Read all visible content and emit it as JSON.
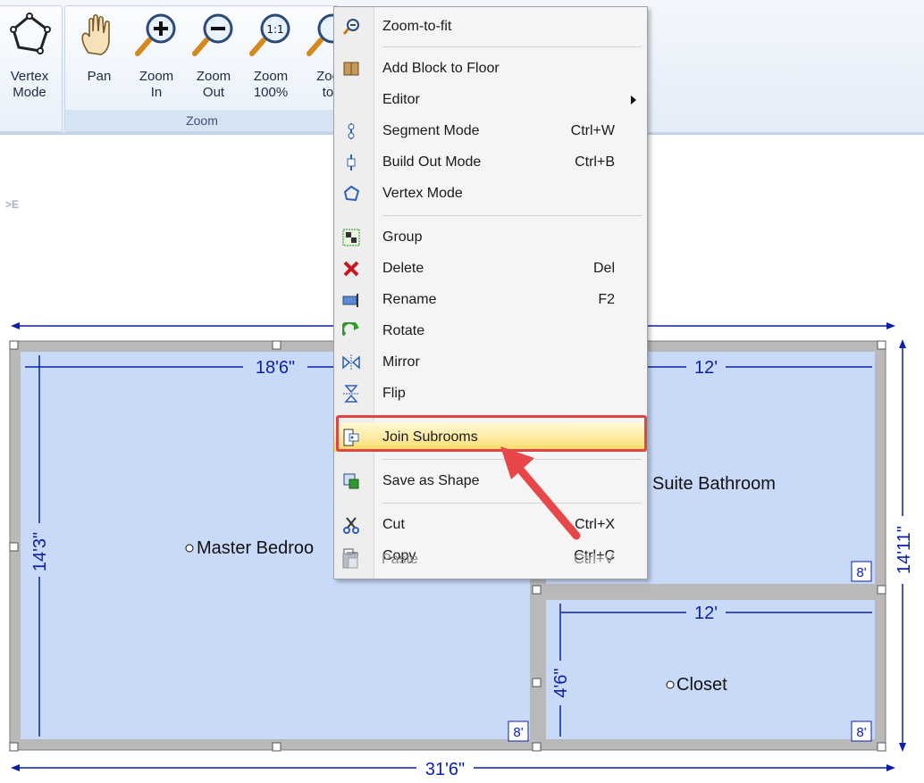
{
  "ribbon": {
    "buttons": [
      {
        "label": "Vertex\nMode",
        "icon": "vertex-mode-icon"
      },
      {
        "label": "Pan",
        "icon": "pan-hand-icon"
      },
      {
        "label": "Zoom\nIn",
        "icon": "zoom-in-icon"
      },
      {
        "label": "Zoom\nOut",
        "icon": "zoom-out-icon"
      },
      {
        "label": "Zoom\n100%",
        "icon": "zoom-100-icon"
      },
      {
        "label": "Zoo\nto",
        "icon": "zoom-to-fit-icon"
      }
    ],
    "zoom_group_label": "Zoom"
  },
  "canvas": {
    "context_note": ">E"
  },
  "plan": {
    "rooms": {
      "master": "Master Bedroo",
      "bath": "Suite Bathroom",
      "closet": "Closet"
    },
    "dims": {
      "master_width": "18'6\"",
      "master_height": "14'3\"",
      "bath_width": "12'",
      "closet_width": "12'",
      "closet_height": "4'6\"",
      "overall_width": "31'6\"",
      "overall_height": "14'11\"",
      "wall_tag": "8'"
    }
  },
  "menu": {
    "items": [
      {
        "label": "Zoom-to-fit",
        "shortcut": "",
        "icon": "zoom-to-fit-icon"
      },
      {
        "label": "Add Block to Floor",
        "shortcut": "",
        "icon": "add-block-icon"
      },
      {
        "label": "Editor",
        "shortcut": "",
        "icon": ""
      },
      {
        "label": "Segment Mode",
        "shortcut": "Ctrl+W",
        "icon": "segment-mode-icon"
      },
      {
        "label": "Build Out Mode",
        "shortcut": "Ctrl+B",
        "icon": "build-out-mode-icon"
      },
      {
        "label": "Vertex Mode",
        "shortcut": "",
        "icon": "vertex-mode-icon"
      },
      {
        "label": "Group",
        "shortcut": "",
        "icon": "group-icon"
      },
      {
        "label": "Delete",
        "shortcut": "Del",
        "icon": "delete-icon"
      },
      {
        "label": "Rename",
        "shortcut": "F2",
        "icon": "rename-icon"
      },
      {
        "label": "Rotate",
        "shortcut": "",
        "icon": "rotate-icon"
      },
      {
        "label": "Mirror",
        "shortcut": "",
        "icon": "mirror-icon"
      },
      {
        "label": "Flip",
        "shortcut": "",
        "icon": "flip-icon"
      },
      {
        "label": "Join Subrooms",
        "shortcut": "",
        "icon": "join-subrooms-icon"
      },
      {
        "label": "Save as Shape",
        "shortcut": "",
        "icon": "save-as-shape-icon"
      },
      {
        "label": "Cut",
        "shortcut": "Ctrl+X",
        "icon": "cut-icon"
      },
      {
        "label": "Copy",
        "shortcut": "Ctrl+C",
        "icon": "copy-icon"
      },
      {
        "label": "Paste",
        "shortcut": "Ctrl+V",
        "icon": "paste-icon"
      }
    ]
  },
  "colors": {
    "room_fill": "#c9daf9",
    "wall": "#b9b9b9",
    "dimension": "#0b1fa8",
    "highlight_border": "#e04545",
    "arrow": "#e8474a"
  }
}
